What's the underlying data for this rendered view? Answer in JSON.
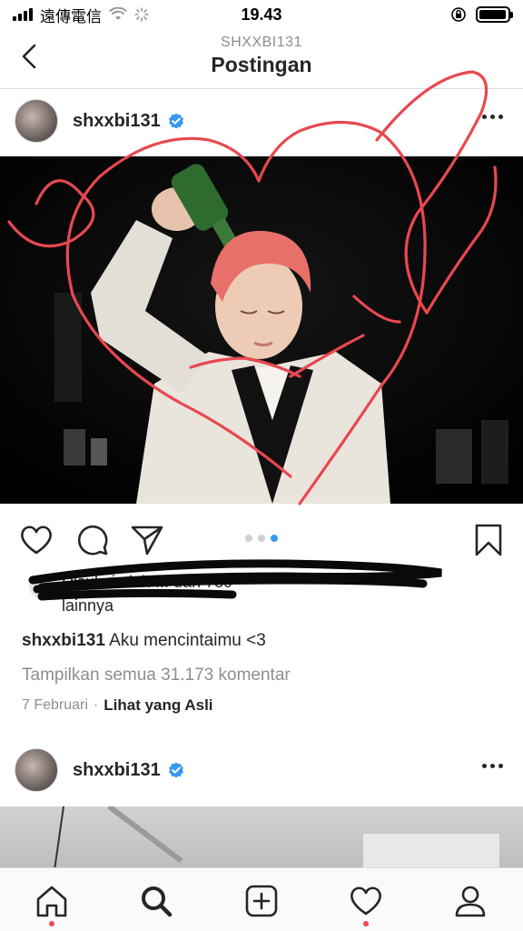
{
  "status_bar": {
    "carrier": "遠傳電信",
    "time": "19.43",
    "battery_level": 0.95
  },
  "header": {
    "subtitle": "SHXXBI131",
    "title": "Postingan"
  },
  "post1": {
    "username": "shxxbi131",
    "likes_text_line1": "Disukai oleh ... dan 789",
    "likes_text_line2": "lainnya",
    "caption_user": "shxxbi131",
    "caption_text": "Aku mencintaimu <3",
    "comments_link": "Tampilkan semua 31.173 komentar",
    "date": "7 Februari",
    "separator": "·",
    "see_original": "Lihat yang Asli",
    "carousel_pages": 3,
    "carousel_active_index": 2
  },
  "post2": {
    "username": "shxxbi131"
  },
  "colors": {
    "annotation_red": "#e8484f",
    "verified_blue": "#3897f0",
    "notification_red": "#ed4956"
  },
  "icons": [
    "back-chevron-icon",
    "verified-badge-icon",
    "more-dots-icon",
    "heart-icon",
    "comment-icon",
    "share-icon",
    "bookmark-icon",
    "home-icon",
    "search-icon",
    "add-post-icon",
    "activity-heart-icon",
    "profile-icon"
  ]
}
